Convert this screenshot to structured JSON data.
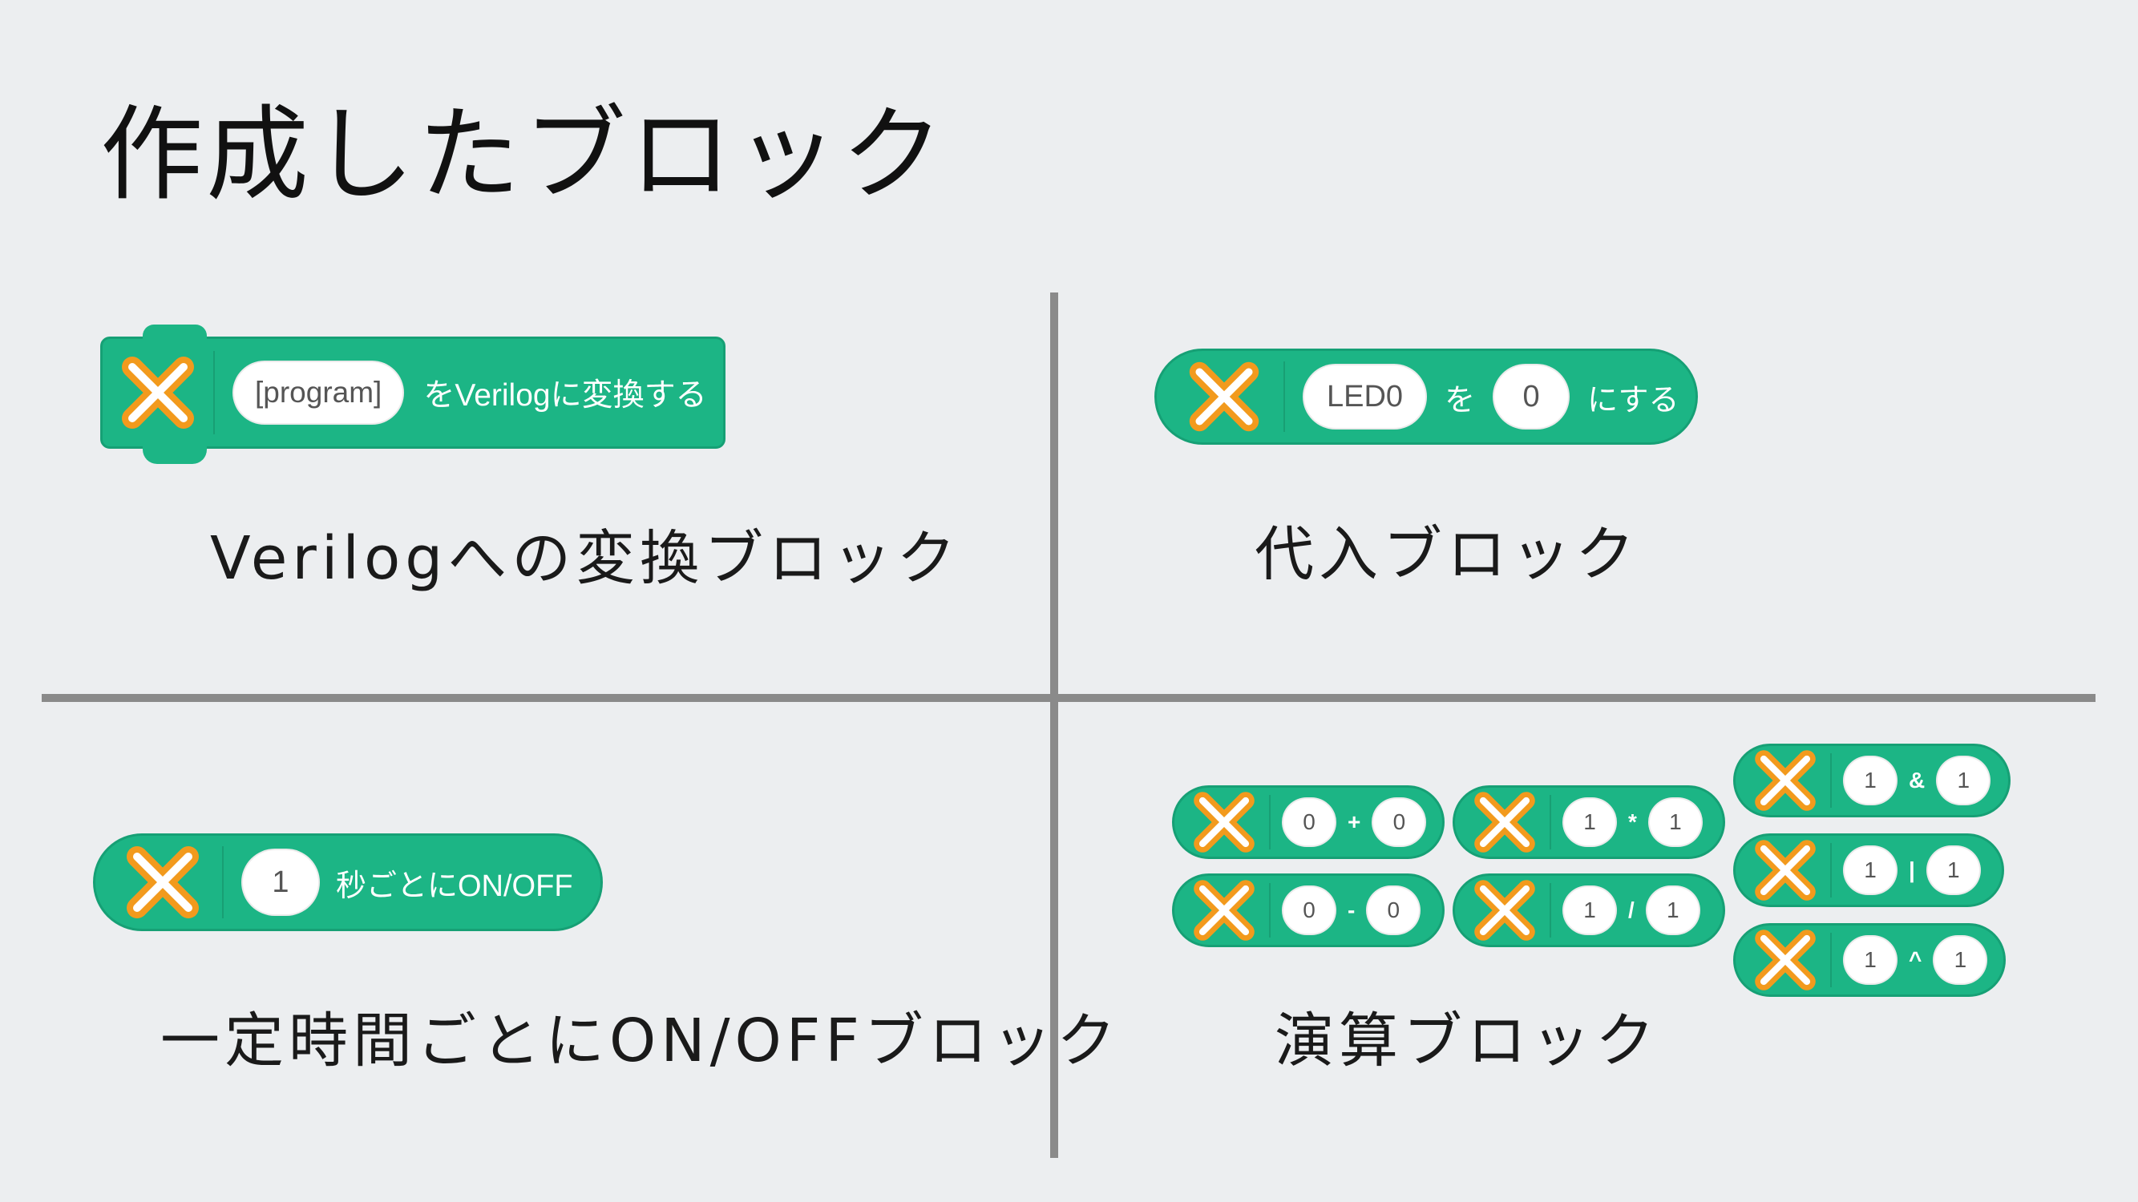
{
  "title": "作成したブロック",
  "quadrants": {
    "verilog": {
      "block": {
        "input": "[program]",
        "text": "をVerilogに変換する"
      },
      "caption": "Verilogへの変換ブロック"
    },
    "assign": {
      "block": {
        "input1": "LED0",
        "text1": "を",
        "input2": "0",
        "text2": "にする"
      },
      "caption": "代入ブロック"
    },
    "blink": {
      "block": {
        "input": "1",
        "text": "秒ごとにON/OFF"
      },
      "caption": "一定時間ごとにON/OFFブロック"
    },
    "arith": {
      "blocks": [
        {
          "a": "0",
          "op": "+",
          "b": "0"
        },
        {
          "a": "0",
          "op": "-",
          "b": "0"
        },
        {
          "a": "1",
          "op": "*",
          "b": "1"
        },
        {
          "a": "1",
          "op": "/",
          "b": "1"
        },
        {
          "a": "1",
          "op": "&",
          "b": "1"
        },
        {
          "a": "1",
          "op": "|",
          "b": "1"
        },
        {
          "a": "1",
          "op": "^",
          "b": "1"
        }
      ],
      "caption": "演算ブロック"
    }
  },
  "colors": {
    "block": "#1CB585",
    "icon_outer": "#F29A1D",
    "icon_inner": "#FFFFFF",
    "background": "#ECEEF0",
    "divider": "#8A8A8A"
  },
  "icons": {
    "block_icon": "x-cross-icon"
  }
}
